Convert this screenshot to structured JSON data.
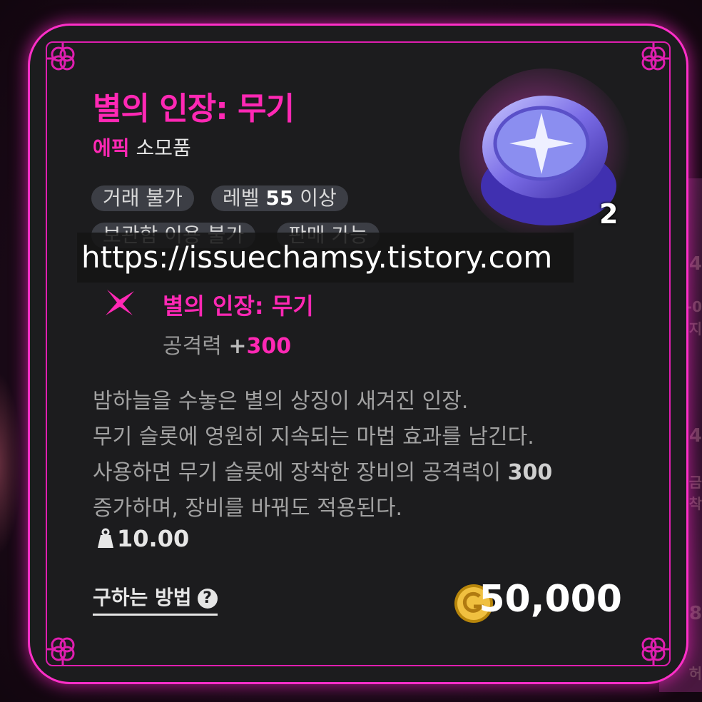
{
  "item": {
    "name": "별의 인장: 무기",
    "rarity": "에픽",
    "category": "소모품",
    "stack_count": "2"
  },
  "tags": [
    {
      "text": "거래 불가"
    },
    {
      "prefix": "레벨 ",
      "bold": "55",
      "suffix": " 이상"
    },
    {
      "text": "보관함 이용 불가"
    },
    {
      "text": "판매 가능"
    }
  ],
  "watermark": "https://issuechamsy.tistory.com",
  "effect": {
    "name": "별의 인장: 무기",
    "stat_label": "공격력",
    "stat_plus": "+",
    "stat_value": "300"
  },
  "description": {
    "line1": "밤하늘을 수놓은 별의 상징이 새겨진 인장.",
    "line2": "무기 슬롯에 영원히 지속되는 마법 효과를 남긴다.",
    "line3_a": "사용하면 무기 슬롯에 장착한 장비의 공격력이 ",
    "line3_b": "300",
    "line4": "증가하며, 장비를 바꿔도 적용된다."
  },
  "weight": "10.00",
  "how_to_obtain": "구하는 방법",
  "help_symbol": "?",
  "price": "50,000",
  "background_right_fragments": [
    "4",
    "-0",
    "지",
    "4",
    "금",
    "착",
    "8",
    "허"
  ],
  "colors": {
    "accent_pink": "#ff28b4",
    "frame_glow": "#ff2fc8",
    "card_bg": "#1c1c1e",
    "tag_bg": "#3c3e45"
  },
  "icons": [
    "star-sparkle-icon",
    "weight-icon",
    "help-icon",
    "gold-coin-icon",
    "ring-item-icon",
    "celtic-knot-icon"
  ]
}
